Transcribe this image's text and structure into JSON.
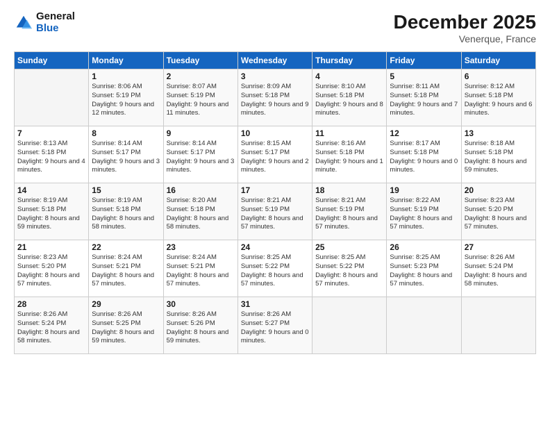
{
  "logo": {
    "line1": "General",
    "line2": "Blue"
  },
  "title": "December 2025",
  "location": "Venerque, France",
  "header": {
    "days": [
      "Sunday",
      "Monday",
      "Tuesday",
      "Wednesday",
      "Thursday",
      "Friday",
      "Saturday"
    ]
  },
  "weeks": [
    [
      {
        "num": "",
        "sunrise": "",
        "sunset": "",
        "daylight": ""
      },
      {
        "num": "1",
        "sunrise": "Sunrise: 8:06 AM",
        "sunset": "Sunset: 5:19 PM",
        "daylight": "Daylight: 9 hours and 12 minutes."
      },
      {
        "num": "2",
        "sunrise": "Sunrise: 8:07 AM",
        "sunset": "Sunset: 5:19 PM",
        "daylight": "Daylight: 9 hours and 11 minutes."
      },
      {
        "num": "3",
        "sunrise": "Sunrise: 8:09 AM",
        "sunset": "Sunset: 5:18 PM",
        "daylight": "Daylight: 9 hours and 9 minutes."
      },
      {
        "num": "4",
        "sunrise": "Sunrise: 8:10 AM",
        "sunset": "Sunset: 5:18 PM",
        "daylight": "Daylight: 9 hours and 8 minutes."
      },
      {
        "num": "5",
        "sunrise": "Sunrise: 8:11 AM",
        "sunset": "Sunset: 5:18 PM",
        "daylight": "Daylight: 9 hours and 7 minutes."
      },
      {
        "num": "6",
        "sunrise": "Sunrise: 8:12 AM",
        "sunset": "Sunset: 5:18 PM",
        "daylight": "Daylight: 9 hours and 6 minutes."
      }
    ],
    [
      {
        "num": "7",
        "sunrise": "Sunrise: 8:13 AM",
        "sunset": "Sunset: 5:18 PM",
        "daylight": "Daylight: 9 hours and 4 minutes."
      },
      {
        "num": "8",
        "sunrise": "Sunrise: 8:14 AM",
        "sunset": "Sunset: 5:17 PM",
        "daylight": "Daylight: 9 hours and 3 minutes."
      },
      {
        "num": "9",
        "sunrise": "Sunrise: 8:14 AM",
        "sunset": "Sunset: 5:17 PM",
        "daylight": "Daylight: 9 hours and 3 minutes."
      },
      {
        "num": "10",
        "sunrise": "Sunrise: 8:15 AM",
        "sunset": "Sunset: 5:17 PM",
        "daylight": "Daylight: 9 hours and 2 minutes."
      },
      {
        "num": "11",
        "sunrise": "Sunrise: 8:16 AM",
        "sunset": "Sunset: 5:18 PM",
        "daylight": "Daylight: 9 hours and 1 minute."
      },
      {
        "num": "12",
        "sunrise": "Sunrise: 8:17 AM",
        "sunset": "Sunset: 5:18 PM",
        "daylight": "Daylight: 9 hours and 0 minutes."
      },
      {
        "num": "13",
        "sunrise": "Sunrise: 8:18 AM",
        "sunset": "Sunset: 5:18 PM",
        "daylight": "Daylight: 8 hours and 59 minutes."
      }
    ],
    [
      {
        "num": "14",
        "sunrise": "Sunrise: 8:19 AM",
        "sunset": "Sunset: 5:18 PM",
        "daylight": "Daylight: 8 hours and 59 minutes."
      },
      {
        "num": "15",
        "sunrise": "Sunrise: 8:19 AM",
        "sunset": "Sunset: 5:18 PM",
        "daylight": "Daylight: 8 hours and 58 minutes."
      },
      {
        "num": "16",
        "sunrise": "Sunrise: 8:20 AM",
        "sunset": "Sunset: 5:18 PM",
        "daylight": "Daylight: 8 hours and 58 minutes."
      },
      {
        "num": "17",
        "sunrise": "Sunrise: 8:21 AM",
        "sunset": "Sunset: 5:19 PM",
        "daylight": "Daylight: 8 hours and 57 minutes."
      },
      {
        "num": "18",
        "sunrise": "Sunrise: 8:21 AM",
        "sunset": "Sunset: 5:19 PM",
        "daylight": "Daylight: 8 hours and 57 minutes."
      },
      {
        "num": "19",
        "sunrise": "Sunrise: 8:22 AM",
        "sunset": "Sunset: 5:19 PM",
        "daylight": "Daylight: 8 hours and 57 minutes."
      },
      {
        "num": "20",
        "sunrise": "Sunrise: 8:23 AM",
        "sunset": "Sunset: 5:20 PM",
        "daylight": "Daylight: 8 hours and 57 minutes."
      }
    ],
    [
      {
        "num": "21",
        "sunrise": "Sunrise: 8:23 AM",
        "sunset": "Sunset: 5:20 PM",
        "daylight": "Daylight: 8 hours and 57 minutes."
      },
      {
        "num": "22",
        "sunrise": "Sunrise: 8:24 AM",
        "sunset": "Sunset: 5:21 PM",
        "daylight": "Daylight: 8 hours and 57 minutes."
      },
      {
        "num": "23",
        "sunrise": "Sunrise: 8:24 AM",
        "sunset": "Sunset: 5:21 PM",
        "daylight": "Daylight: 8 hours and 57 minutes."
      },
      {
        "num": "24",
        "sunrise": "Sunrise: 8:25 AM",
        "sunset": "Sunset: 5:22 PM",
        "daylight": "Daylight: 8 hours and 57 minutes."
      },
      {
        "num": "25",
        "sunrise": "Sunrise: 8:25 AM",
        "sunset": "Sunset: 5:22 PM",
        "daylight": "Daylight: 8 hours and 57 minutes."
      },
      {
        "num": "26",
        "sunrise": "Sunrise: 8:25 AM",
        "sunset": "Sunset: 5:23 PM",
        "daylight": "Daylight: 8 hours and 57 minutes."
      },
      {
        "num": "27",
        "sunrise": "Sunrise: 8:26 AM",
        "sunset": "Sunset: 5:24 PM",
        "daylight": "Daylight: 8 hours and 58 minutes."
      }
    ],
    [
      {
        "num": "28",
        "sunrise": "Sunrise: 8:26 AM",
        "sunset": "Sunset: 5:24 PM",
        "daylight": "Daylight: 8 hours and 58 minutes."
      },
      {
        "num": "29",
        "sunrise": "Sunrise: 8:26 AM",
        "sunset": "Sunset: 5:25 PM",
        "daylight": "Daylight: 8 hours and 59 minutes."
      },
      {
        "num": "30",
        "sunrise": "Sunrise: 8:26 AM",
        "sunset": "Sunset: 5:26 PM",
        "daylight": "Daylight: 8 hours and 59 minutes."
      },
      {
        "num": "31",
        "sunrise": "Sunrise: 8:26 AM",
        "sunset": "Sunset: 5:27 PM",
        "daylight": "Daylight: 9 hours and 0 minutes."
      },
      {
        "num": "",
        "sunrise": "",
        "sunset": "",
        "daylight": ""
      },
      {
        "num": "",
        "sunrise": "",
        "sunset": "",
        "daylight": ""
      },
      {
        "num": "",
        "sunrise": "",
        "sunset": "",
        "daylight": ""
      }
    ]
  ]
}
